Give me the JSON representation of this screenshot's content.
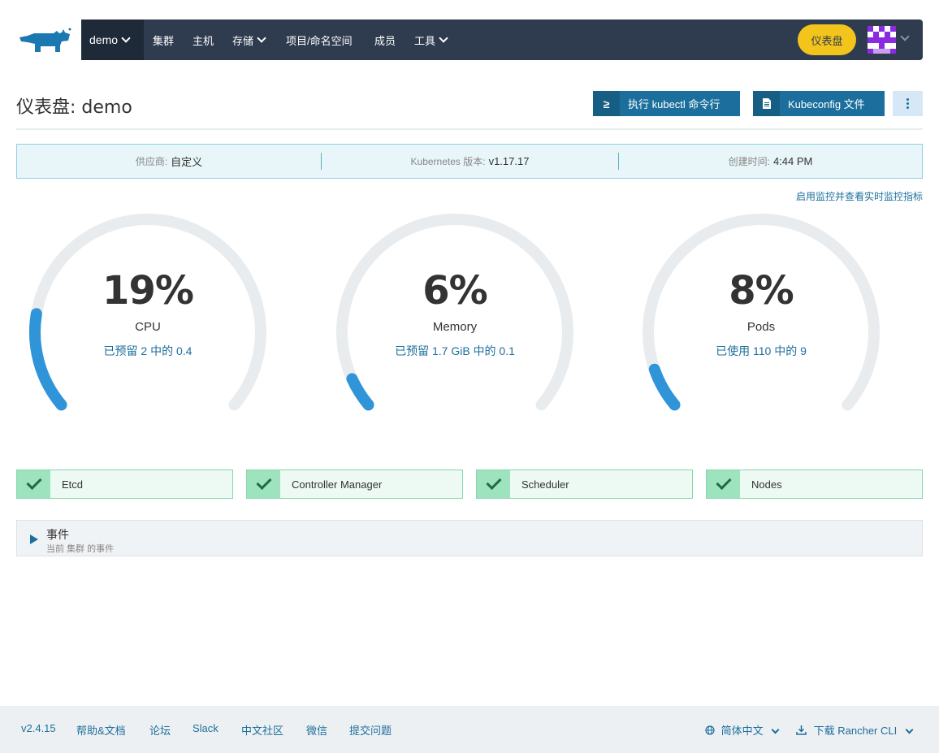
{
  "header": {
    "cluster_name": "demo",
    "nav": [
      "集群",
      "主机",
      "存储",
      "项目/命名空间",
      "成员",
      "工具"
    ],
    "dashboard_button": "仪表盘"
  },
  "page": {
    "title": "仪表盘: demo",
    "kubectl_button": "执行 kubectl 命令行",
    "kubeconfig_button": "Kubeconfig 文件"
  },
  "info": {
    "provider_label": "供应商:",
    "provider_value": "自定义",
    "k8s_label": "Kubernetes 版本:",
    "k8s_value": "v1.17.17",
    "created_label": "创建时间:",
    "created_value": "4:44 PM"
  },
  "monitor_link": "启用监控并查看实时监控指标",
  "gauges": [
    {
      "value": "19%",
      "label": "CPU",
      "sub": "已预留 2 中的 0.4",
      "percent": 19
    },
    {
      "value": "6%",
      "label": "Memory",
      "sub": "已预留 1.7 GiB 中的 0.1",
      "percent": 6
    },
    {
      "value": "8%",
      "label": "Pods",
      "sub": "已使用 110 中的 9",
      "percent": 8
    }
  ],
  "status": [
    "Etcd",
    "Controller Manager",
    "Scheduler",
    "Nodes"
  ],
  "events": {
    "title": "事件",
    "subtitle": "当前 集群 的事件"
  },
  "footer": {
    "version": "v2.4.15",
    "help": "帮助&文档",
    "forum": "论坛",
    "slack": "Slack",
    "community": "中文社区",
    "wechat": "微信",
    "issue": "提交问题",
    "language": "简体中文",
    "download": "下载 Rancher CLI"
  },
  "colors": {
    "accent": "#1c6f9c",
    "nav_bg": "#2f3c4f",
    "gauge_fill": "#3094d9",
    "gauge_track": "#e9ecee",
    "status_ok": "#9de3bd"
  }
}
